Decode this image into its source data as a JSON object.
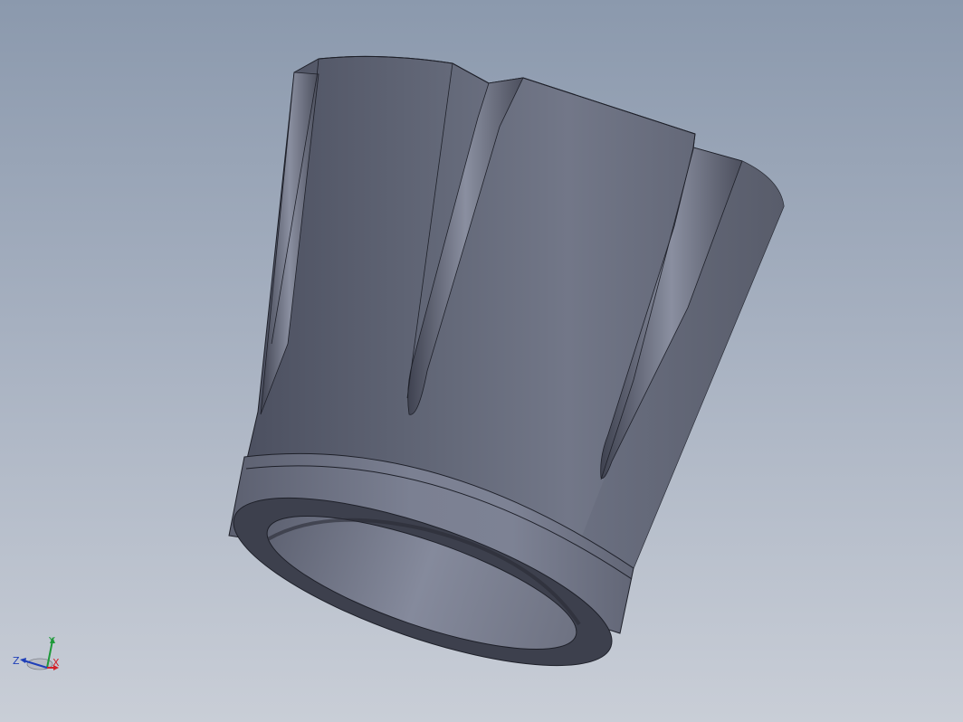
{
  "viewport": {
    "background_top": "#8b99ad",
    "background_bottom": "#c9ced7"
  },
  "model": {
    "body_color": "#6a6f80",
    "edge_color": "#1e2029"
  },
  "triad": {
    "x_label": "X",
    "y_label": "Y",
    "z_label": "Z",
    "x_color": "#d2232a",
    "y_color": "#1f9a3a",
    "z_color": "#1f3fb8"
  }
}
